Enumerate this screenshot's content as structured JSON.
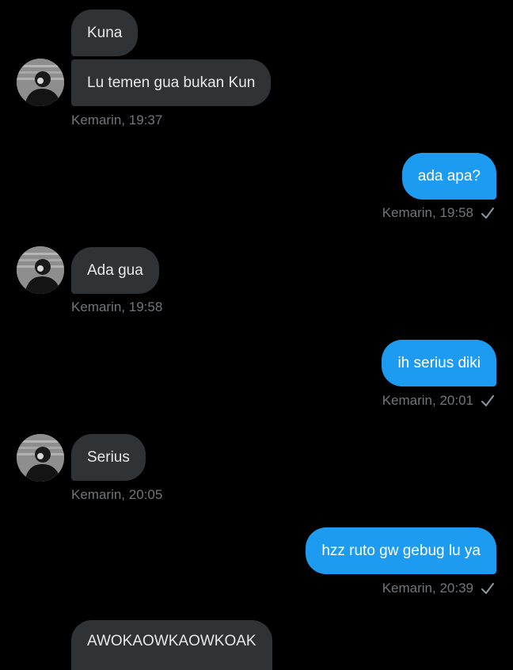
{
  "messages": [
    {
      "text": "Kuna",
      "direction": "received"
    },
    {
      "text": "Lu temen gua bukan Kun",
      "direction": "received",
      "time": "Kemarin, 19:37"
    },
    {
      "text": "ada apa?",
      "direction": "sent",
      "time": "Kemarin, 19:58",
      "status_icon": "check-icon"
    },
    {
      "text": "Ada gua",
      "direction": "received",
      "time": "Kemarin, 19:58"
    },
    {
      "text": "ih serius diki",
      "direction": "sent",
      "time": "Kemarin, 20:01",
      "status_icon": "check-icon"
    },
    {
      "text": "Serius",
      "direction": "received",
      "time": "Kemarin, 20:05"
    },
    {
      "text": "hzz ruto gw gebug lu ya",
      "direction": "sent",
      "time": "Kemarin, 20:39",
      "status_icon": "check-icon"
    },
    {
      "text": "AWOKAOWKAOWKOAK",
      "direction": "received"
    }
  ],
  "colors": {
    "background": "#000000",
    "received_bubble": "#2f3336",
    "sent_bubble": "#1d9bf0",
    "timestamp": "#71767b"
  }
}
